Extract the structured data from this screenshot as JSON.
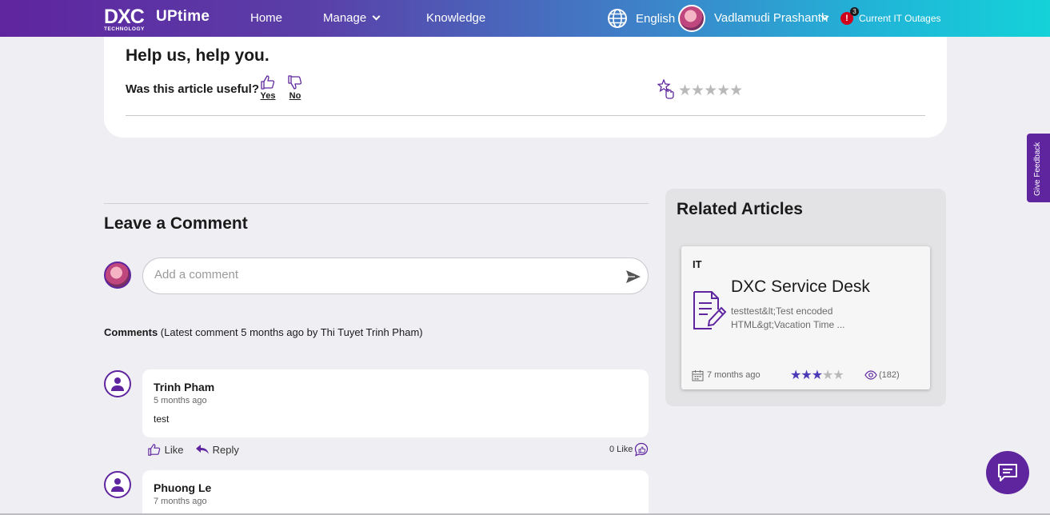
{
  "header": {
    "logo_text": "DXC",
    "logo_sub": "TECHNOLOGY",
    "product": "UPtime",
    "nav": {
      "home": "Home",
      "manage": "Manage",
      "knowledge": "Knowledge"
    },
    "language": "English",
    "user_name": "Vadlamudi Prashanth",
    "alert_symbol": "!",
    "alert_count": "3",
    "outages_label": "Current IT Outages",
    "gradient": [
      "#5f259f",
      "#14d2d8"
    ]
  },
  "help": {
    "title": "Help us, help you.",
    "question": "Was this article useful?",
    "yes": "Yes",
    "no": "No",
    "rating_stars": "★★★★★",
    "rating_value": 0
  },
  "comments": {
    "title": "Leave a Comment",
    "placeholder": "Add a comment",
    "meta_bold": "Comments",
    "meta_rest": " (Latest comment 5 months ago by Thi Tuyet Trinh Pham)",
    "items": [
      {
        "name": "Trinh Pham",
        "time": "5 months ago",
        "text": "test",
        "like": "Like",
        "reply": "Reply",
        "like_count": "0 Like"
      },
      {
        "name": "Phuong Le",
        "time": "7 months ago"
      }
    ]
  },
  "related": {
    "title": "Related Articles",
    "article": {
      "category": "IT",
      "title": "DXC Service Desk",
      "description": "testtest&lt;Test encoded HTML&gt;Vacation Time  ...",
      "date": "7 months ago",
      "rating": 3,
      "rating_max": 5,
      "stars_on": "★★★",
      "stars_off": "★★",
      "views": "(182)"
    }
  },
  "side": {
    "give_feedback": "Give Feedback"
  },
  "colors": {
    "accent": "#5f259f",
    "star": "#4b3ab8",
    "background": "#efeff3"
  }
}
